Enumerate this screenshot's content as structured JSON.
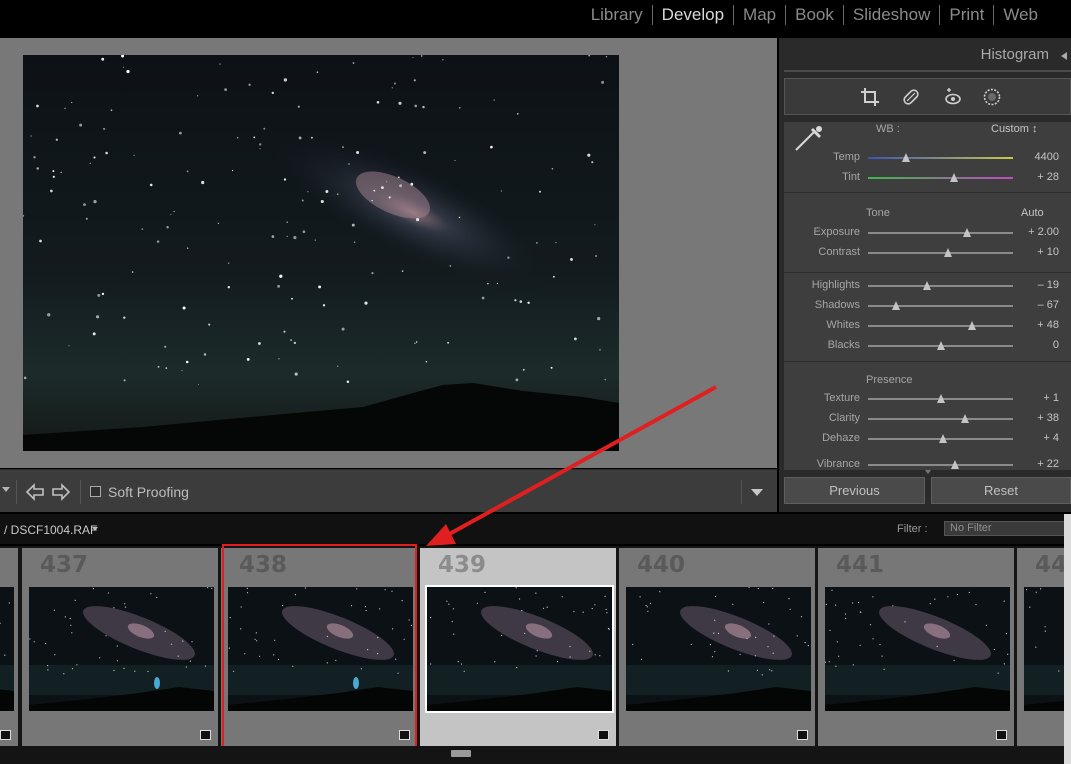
{
  "modules": [
    "Library",
    "Develop",
    "Map",
    "Book",
    "Slideshow",
    "Print",
    "Web"
  ],
  "active_module": "Develop",
  "toolbar": {
    "soft_proofing_label": "Soft Proofing"
  },
  "right_panel": {
    "histogram_title": "Histogram",
    "wb": {
      "label": "WB :",
      "value": "Custom ↕"
    },
    "tone_title": "Tone",
    "auto_label": "Auto",
    "presence_title": "Presence",
    "sliders": [
      {
        "label": "Temp",
        "value": "4400",
        "pos": 0.26
      },
      {
        "label": "Tint",
        "value": "+ 28",
        "pos": 0.59
      },
      {
        "label": "Exposure",
        "value": "+ 2.00",
        "pos": 0.68
      },
      {
        "label": "Contrast",
        "value": "+ 10",
        "pos": 0.55
      },
      {
        "label": "Highlights",
        "value": "– 19",
        "pos": 0.41
      },
      {
        "label": "Shadows",
        "value": "– 67",
        "pos": 0.19
      },
      {
        "label": "Whites",
        "value": "+ 48",
        "pos": 0.72
      },
      {
        "label": "Blacks",
        "value": "0",
        "pos": 0.5
      },
      {
        "label": "Texture",
        "value": "+ 1",
        "pos": 0.5
      },
      {
        "label": "Clarity",
        "value": "+ 38",
        "pos": 0.67
      },
      {
        "label": "Dehaze",
        "value": "+ 4",
        "pos": 0.52
      },
      {
        "label": "Vibrance",
        "value": "+ 22",
        "pos": 0.6
      }
    ],
    "previous_label": "Previous",
    "reset_label": "Reset"
  },
  "filmstrip": {
    "filename": "/ DSCF1004.RAF",
    "filter_label": "Filter :",
    "filter_value": "No Filter",
    "cells": [
      {
        "number": "",
        "selected": false
      },
      {
        "number": "437",
        "selected": false
      },
      {
        "number": "438",
        "selected": false
      },
      {
        "number": "439",
        "selected": true
      },
      {
        "number": "440",
        "selected": false
      },
      {
        "number": "441",
        "selected": false
      },
      {
        "number": "44",
        "selected": false
      }
    ]
  },
  "colors": {
    "annotation_red": "#e02020",
    "accent_selected": "#c4c4c4"
  }
}
